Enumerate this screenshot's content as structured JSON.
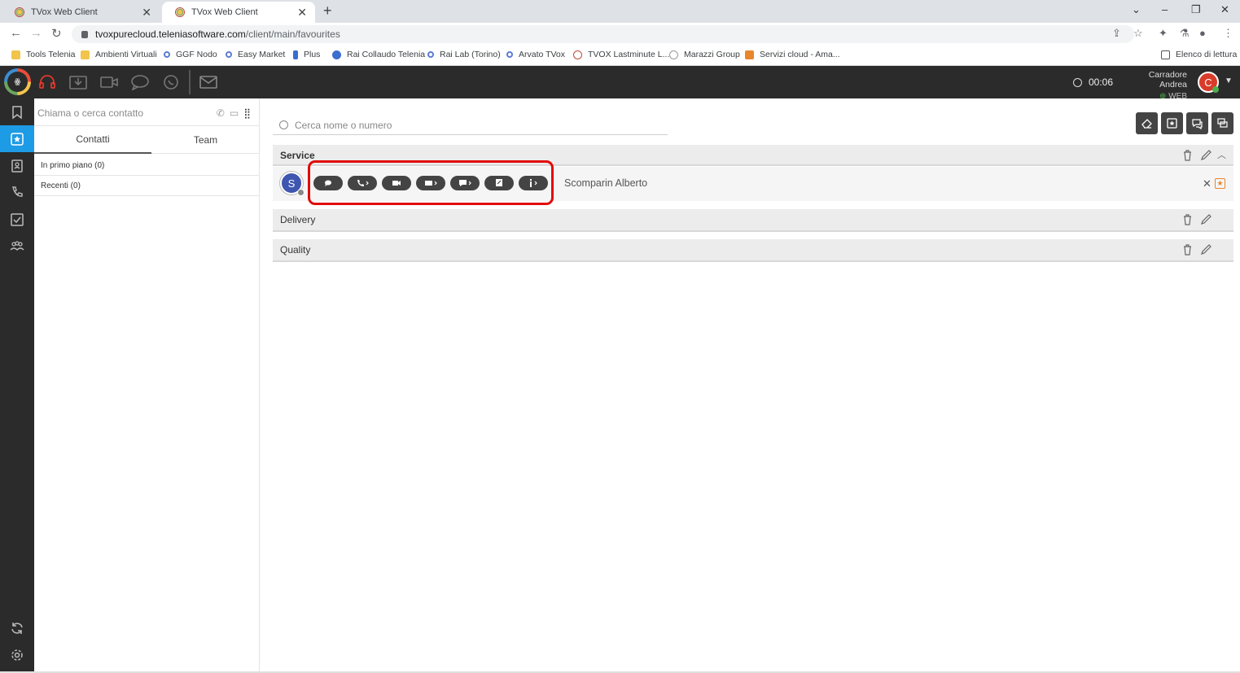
{
  "browser": {
    "tabs": [
      {
        "title": "TVox Web Client"
      },
      {
        "title": "TVox Web Client"
      }
    ],
    "url_host": "tvoxpurecloud.teleniasoftware.com",
    "url_path": "/client/main/favourites",
    "bookmarks": [
      {
        "label": "Tools Telenia",
        "icon": "folder-icon"
      },
      {
        "label": "Ambienti Virtuali",
        "icon": "folder-icon"
      },
      {
        "label": "GGF Nodo",
        "icon": "key-icon"
      },
      {
        "label": "Easy Market",
        "icon": "key-icon"
      },
      {
        "label": "Plus",
        "icon": "plus-site-icon"
      },
      {
        "label": "Rai Collaudo Telenia",
        "icon": "globe-icon"
      },
      {
        "label": "Rai Lab (Torino)",
        "icon": "key-icon"
      },
      {
        "label": "Arvato TVox",
        "icon": "key-icon"
      },
      {
        "label": "TVOX Lastminute L...",
        "icon": "tvox-icon"
      },
      {
        "label": "Marazzi Group",
        "icon": "marazzi-icon"
      },
      {
        "label": "Servizi cloud - Ama...",
        "icon": "aws-icon"
      }
    ],
    "reading_list": "Elenco di lettura"
  },
  "header": {
    "timer": "00:06",
    "user_name": "Carradore Andrea",
    "user_status": "WEB",
    "avatar_initial": "C"
  },
  "contacts_panel": {
    "search_placeholder": "Chiama o cerca contatto",
    "tabs": [
      "Contatti",
      "Team"
    ],
    "groups": [
      "In primo piano (0)",
      "Recenti (0)"
    ]
  },
  "main": {
    "search_placeholder": "Cerca nome o numero",
    "groups": [
      {
        "name": "Service",
        "contacts": [
          {
            "initial": "S",
            "name": "Scomparin Alberto"
          }
        ]
      },
      {
        "name": "Delivery"
      },
      {
        "name": "Quality"
      }
    ]
  },
  "colors": {
    "app_dark": "#2b2b2b",
    "active_nav": "#1e9be5",
    "highlight": "#e20a0a",
    "avatar_user": "#d93b2a",
    "avatar_contact": "#3e56b0"
  }
}
